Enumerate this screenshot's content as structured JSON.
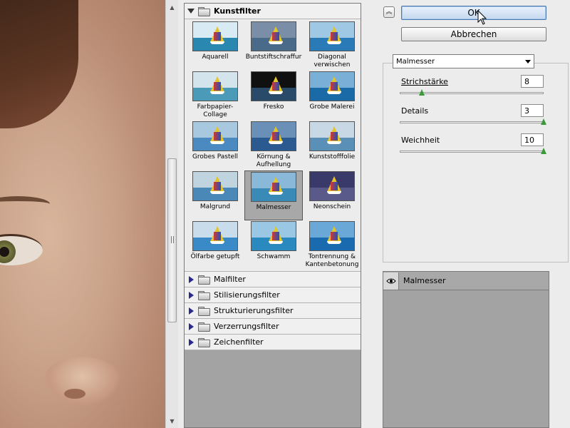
{
  "gallery": {
    "open_category": "Kunstfilter",
    "thumbnails": [
      {
        "label": "Aquarell"
      },
      {
        "label": "Buntstiftschraffur"
      },
      {
        "label": "Diagonal verwischen"
      },
      {
        "label": "Farbpapier-Collage"
      },
      {
        "label": "Fresko"
      },
      {
        "label": "Grobe Malerei"
      },
      {
        "label": "Grobes Pastell"
      },
      {
        "label": "Körnung & Aufhellung"
      },
      {
        "label": "Kunststofffolie"
      },
      {
        "label": "Malgrund"
      },
      {
        "label": "Malmesser"
      },
      {
        "label": "Neonschein"
      },
      {
        "label": "Ölfarbe getupft"
      },
      {
        "label": "Schwamm"
      },
      {
        "label": "Tontrennung & Kantenbetonung"
      }
    ],
    "selected_index": 10,
    "categories": [
      "Malfilter",
      "Stilisierungsfilter",
      "Strukturierungsfilter",
      "Verzerrungsfilter",
      "Zeichenfilter"
    ]
  },
  "buttons": {
    "ok": "OK",
    "cancel": "Abbrechen"
  },
  "settings": {
    "filter_select": "Malmesser",
    "params": [
      {
        "label": "Strichstärke",
        "value": "8",
        "min": 1,
        "max": 50
      },
      {
        "label": "Details",
        "value": "3",
        "min": 1,
        "max": 3
      },
      {
        "label": "Weichheit",
        "value": "10",
        "min": 0,
        "max": 10
      }
    ]
  },
  "layers": {
    "items": [
      {
        "name": "Malmesser"
      }
    ]
  },
  "icons": {
    "collapse": "double-chevron-up-icon",
    "expand": "triangle-right-icon",
    "folder": "folder-icon",
    "visibility": "eye-icon",
    "cursor": "mouse-pointer-icon"
  }
}
